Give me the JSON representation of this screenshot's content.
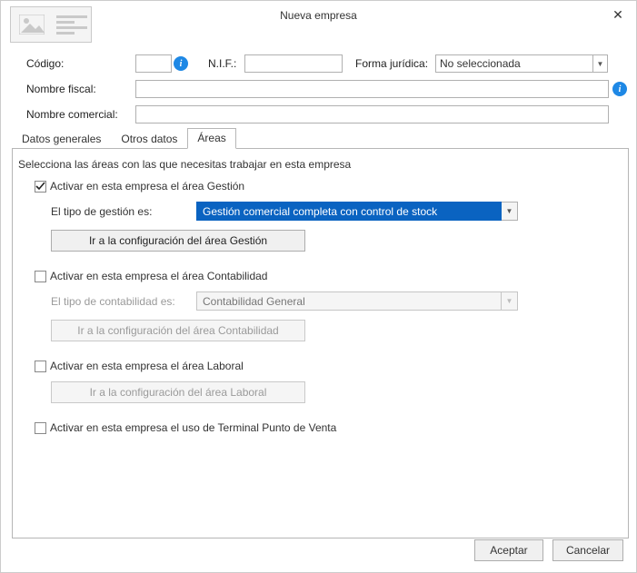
{
  "window": {
    "title": "Nueva empresa",
    "close": "✕"
  },
  "form": {
    "codigo_label": "Código:",
    "codigo_value": "",
    "nif_label": "N.I.F.:",
    "nif_value": "",
    "forma_label": "Forma jurídica:",
    "forma_value": "No seleccionada",
    "nombre_fiscal_label": "Nombre fiscal:",
    "nombre_fiscal_value": "",
    "nombre_comercial_label": "Nombre comercial:",
    "nombre_comercial_value": ""
  },
  "tabs": {
    "t1": "Datos generales",
    "t2": "Otros datos",
    "t3": "Áreas"
  },
  "areas": {
    "desc": "Selecciona las áreas con las que necesitas trabajar en esta empresa",
    "gestion": {
      "chk": "Activar en esta empresa el área Gestión",
      "tipo_label": "El tipo de gestión es:",
      "tipo_value": "Gestión comercial completa con control de stock",
      "btn": "Ir a la configuración del área Gestión"
    },
    "contab": {
      "chk": "Activar en esta empresa el área Contabilidad",
      "tipo_label": "El tipo de contabilidad es:",
      "tipo_value": "Contabilidad General",
      "btn": "Ir a la configuración del área Contabilidad"
    },
    "laboral": {
      "chk": "Activar en esta empresa el área Laboral",
      "btn": "Ir a la configuración del área Laboral"
    },
    "tpv": {
      "chk": "Activar en esta empresa el uso de Terminal Punto de Venta"
    }
  },
  "footer": {
    "accept": "Aceptar",
    "cancel": "Cancelar"
  }
}
